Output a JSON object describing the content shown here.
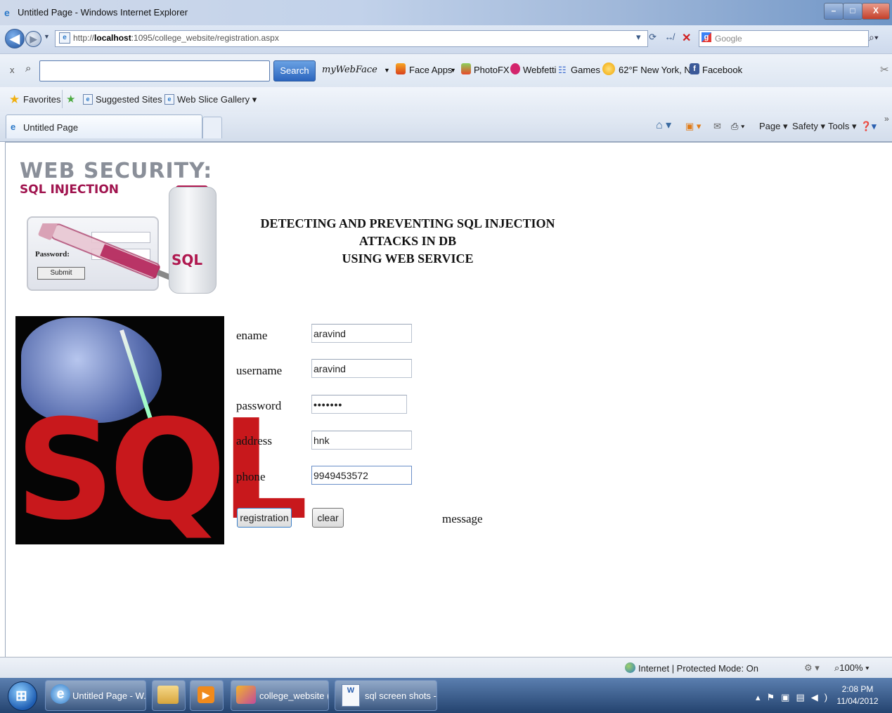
{
  "window": {
    "title": "Untitled Page - Windows Internet Explorer",
    "minimize_glyph": "–",
    "maximize_glyph": "□",
    "close_glyph": "X"
  },
  "address_bar": {
    "url_prefix": "http://",
    "url_host": "localhost",
    "url_rest": ":1095/college_website/registration.aspx",
    "search_placeholder": "Google"
  },
  "toolbar": {
    "close_label": "x",
    "search_value": "",
    "search_button": "Search",
    "mywebface": "myWebFace",
    "face_apps": "Face Apps",
    "photofx": "PhotoFX",
    "webfetti": "Webfetti",
    "games": "Games",
    "weather": "62°F New York, NY",
    "facebook": "Facebook"
  },
  "favorites": {
    "label": "Favorites",
    "suggested_sites": "Suggested Sites",
    "web_slice_gallery": "Web Slice Gallery"
  },
  "tabs": {
    "active": "Untitled Page"
  },
  "command_bar": {
    "page": "Page",
    "safety": "Safety",
    "tools": "Tools"
  },
  "page": {
    "banner_title": "WEB SECURITY:",
    "banner_subtitle": "SQL INJECTION",
    "banner_password_label": "Password:",
    "banner_submit": "Submit",
    "banner_vial_label": "SQL",
    "heading_line1": "DETECTING AND PREVENTING SQL INJECTION ATTACKS IN DB",
    "heading_line2": "USING WEB SERVICE",
    "image_text": "SQL"
  },
  "form": {
    "fields": [
      {
        "label": "ename",
        "value": "aravind"
      },
      {
        "label": "username",
        "value": "aravind"
      },
      {
        "label": "password",
        "value": "•••••••"
      },
      {
        "label": "address",
        "value": "hnk"
      },
      {
        "label": "phone",
        "value": "9949453572"
      }
    ],
    "registration_button": "registration",
    "clear_button": "clear",
    "message_label": "message"
  },
  "status_bar": {
    "zone": "Internet | Protected Mode: On",
    "zoom": "100%"
  },
  "taskbar": {
    "tasks": [
      {
        "label": "Untitled Page - W..."
      },
      {
        "label": "college_website (..."
      },
      {
        "label": "sql screen shots - ..."
      }
    ],
    "time": "2:08 PM",
    "date": "11/04/2012"
  },
  "colors": {
    "accent": "#2b65be",
    "banner_magenta": "#a0134e",
    "sql_red": "#c8181c"
  }
}
